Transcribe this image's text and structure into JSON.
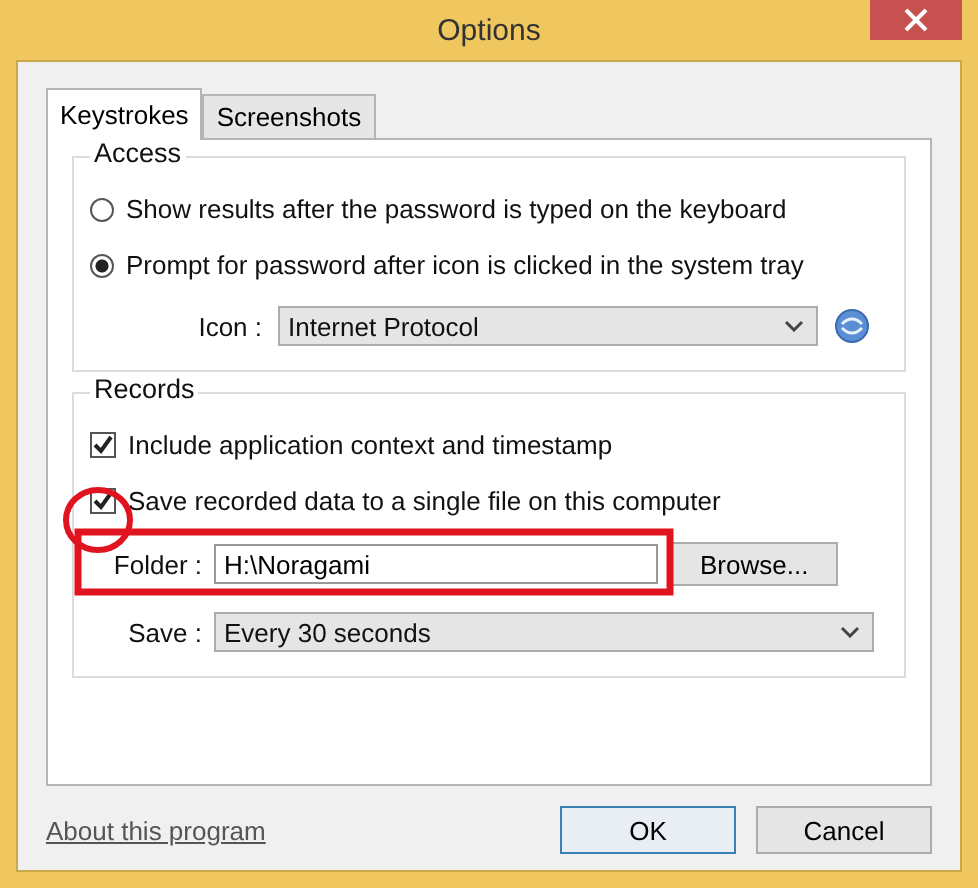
{
  "window": {
    "title": "Options"
  },
  "tabs": [
    {
      "label": "Keystrokes",
      "selected": true
    },
    {
      "label": "Screenshots",
      "selected": false
    }
  ],
  "access": {
    "title": "Access",
    "options": [
      {
        "label": "Show results after the password is typed on the keyboard",
        "selected": false
      },
      {
        "label": "Prompt for password after icon is clicked in the system tray",
        "selected": true
      }
    ],
    "icon_label": "Icon :",
    "icon_value": "Internet Protocol"
  },
  "records": {
    "title": "Records",
    "checks": [
      {
        "label": "Include application context and timestamp",
        "checked": true
      },
      {
        "label": "Save recorded data to a single file on this computer",
        "checked": true
      }
    ],
    "folder_label": "Folder :",
    "folder_value": "H:\\Noragami",
    "browse": "Browse...",
    "save_label": "Save :",
    "save_value": "Every 30 seconds"
  },
  "about_link": "About this program",
  "buttons": [
    "OK",
    "Cancel"
  ]
}
